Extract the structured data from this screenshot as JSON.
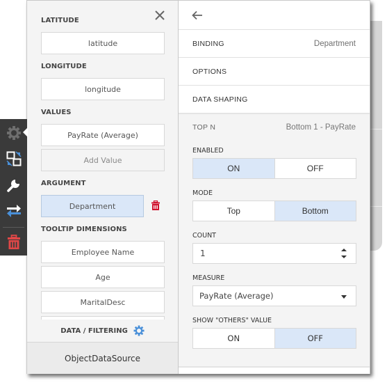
{
  "left_panel": {
    "close_icon": "close-icon",
    "sections": {
      "latitude": {
        "label": "LATITUDE",
        "value": "latitude"
      },
      "longitude": {
        "label": "LONGITUDE",
        "value": "longitude"
      },
      "values": {
        "label": "VALUES",
        "items": [
          "PayRate (Average)"
        ],
        "add_label": "Add Value"
      },
      "argument": {
        "label": "ARGUMENT",
        "value": "Department",
        "delete_icon": "trash-icon"
      },
      "tooltip_dimensions": {
        "label": "TOOLTIP DIMENSIONS",
        "items": [
          "Employee Name",
          "Age",
          "MaritalDesc",
          ""
        ]
      }
    },
    "footer": {
      "filter_label": "DATA / FILTERING",
      "filter_icon": "gear-icon",
      "data_source": "ObjectDataSource"
    }
  },
  "toolbar": {
    "items": [
      {
        "icon": "gear-icon",
        "active": true
      },
      {
        "icon": "convert-icon"
      },
      {
        "icon": "wrench-icon"
      },
      {
        "icon": "swap-icon"
      },
      {
        "icon": "trash-icon"
      }
    ]
  },
  "right_panel": {
    "back_icon": "arrow-left-icon",
    "rows": [
      {
        "key": "BINDING",
        "value": "Department"
      },
      {
        "key": "OPTIONS",
        "value": ""
      },
      {
        "key": "DATA SHAPING",
        "value": ""
      }
    ],
    "top_n": {
      "title": "TOP N",
      "summary": "Bottom 1 - PayRate",
      "enabled": {
        "label": "ENABLED",
        "options": [
          "ON",
          "OFF"
        ],
        "selected": "ON"
      },
      "mode": {
        "label": "MODE",
        "options": [
          "Top",
          "Bottom"
        ],
        "selected": "Bottom"
      },
      "count": {
        "label": "COUNT",
        "value": "1"
      },
      "measure": {
        "label": "MEASURE",
        "value": "PayRate (Average)"
      },
      "show_others": {
        "label": "SHOW \"OTHERS\" VALUE",
        "options": [
          "ON",
          "OFF"
        ],
        "selected": "OFF"
      }
    }
  },
  "colors": {
    "selected_bg": "#dae7f8",
    "accent_blue": "#4a90d9",
    "delete_red": "#d0122e",
    "toolbar_bg": "#3a3a3a"
  }
}
